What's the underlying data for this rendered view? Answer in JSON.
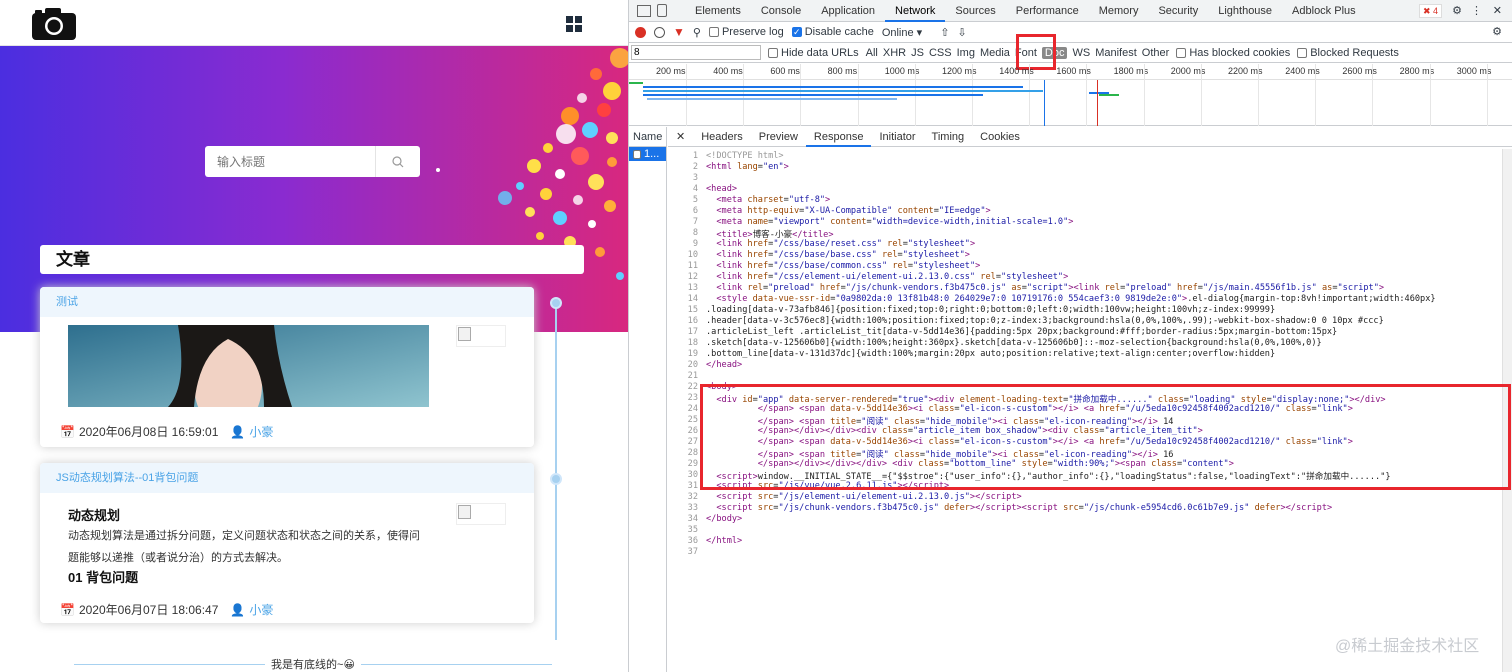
{
  "site": {
    "search_placeholder": "输入标题",
    "section_title": "文章",
    "articles": [
      {
        "title": "测试",
        "date": "2020年06月08日 16:59:01",
        "author": "小豪"
      },
      {
        "title": "JS动态规划算法--01背包问题",
        "heading": "动态规划",
        "summary": "动态规划算法是通过拆分问题，定义问题状态和状态之间的关系，使得问题能够以递推（或者说分治）的方式去解决。",
        "subheading": "01 背包问题",
        "date": "2020年06月07日 18:06:47",
        "author": "小豪"
      }
    ],
    "bottom_text": "我是有底线的~",
    "colors": {
      "gradient_start": "#4b2ee0",
      "gradient_end": "#d8287f",
      "accent": "#4aa3e6"
    }
  },
  "devtools": {
    "tabs": [
      "Elements",
      "Console",
      "Application",
      "Network",
      "Sources",
      "Performance",
      "Memory",
      "Security",
      "Lighthouse",
      "Adblock Plus"
    ],
    "active_tab": "Network",
    "error_count": "4",
    "toolbar": {
      "preserve_log": "Preserve log",
      "disable_cache": "Disable cache",
      "throttle": "Online"
    },
    "filter": {
      "value": "8",
      "hide_data_urls": "Hide data URLs",
      "types": [
        "All",
        "XHR",
        "JS",
        "CSS",
        "Img",
        "Media",
        "Font",
        "Doc",
        "WS",
        "Manifest",
        "Other"
      ],
      "active_type": "Doc",
      "has_blocked_cookies": "Has blocked cookies",
      "blocked_requests": "Blocked Requests"
    },
    "timeline_ticks": [
      "200 ms",
      "400 ms",
      "600 ms",
      "800 ms",
      "1000 ms",
      "1200 ms",
      "1400 ms",
      "1600 ms",
      "1800 ms",
      "2000 ms",
      "2200 ms",
      "2400 ms",
      "2600 ms",
      "2800 ms",
      "3000 ms"
    ],
    "name_header": "Name",
    "request_name": "1...",
    "detail_tabs": [
      "Headers",
      "Preview",
      "Response",
      "Initiator",
      "Timing",
      "Cookies"
    ],
    "active_detail_tab": "Response",
    "watermark": "@稀土掘金技术社区"
  }
}
